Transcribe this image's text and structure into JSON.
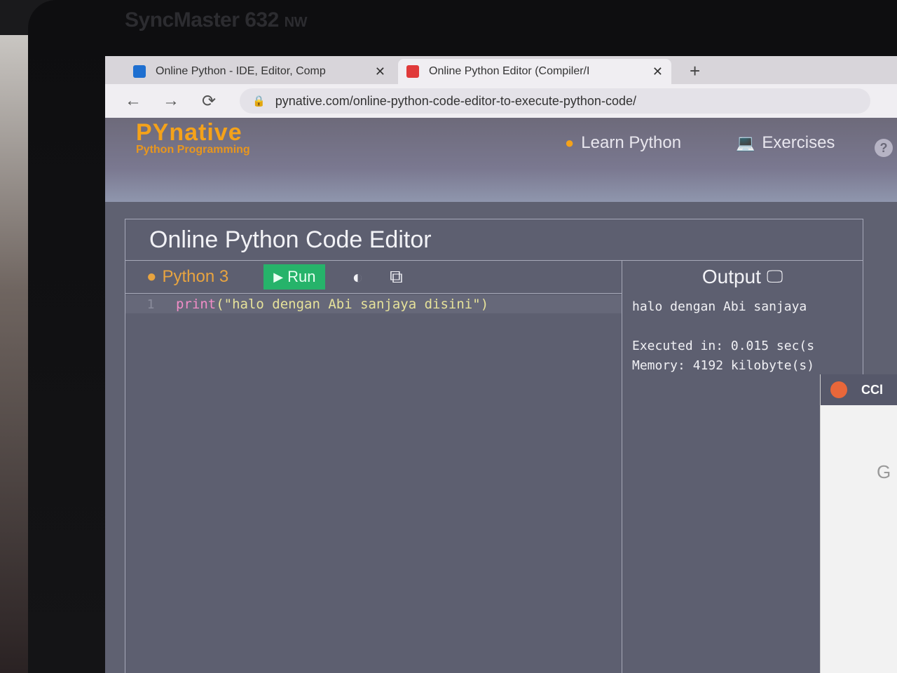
{
  "monitor": {
    "brand": "SyncMaster 632",
    "model_suffix": "NW"
  },
  "browser": {
    "tabs": [
      {
        "title": "Online Python - IDE, Editor, Comp",
        "close": "✕",
        "favicon_color": "#1e6fd0",
        "active": false
      },
      {
        "title": "Online Python Editor (Compiler/I",
        "close": "✕",
        "favicon_color": "#e03a3a",
        "active": true
      }
    ],
    "new_tab": "+",
    "nav": {
      "back": "←",
      "forward": "→",
      "reload": "⟳"
    },
    "url": "pynative.com/online-python-code-editor-to-execute-python-code/"
  },
  "site": {
    "logo_title": "PYnative",
    "logo_subtitle": "Python Programming",
    "nav": [
      {
        "label": "Learn Python",
        "icon": "python-logo-icon"
      },
      {
        "label": "Exercises",
        "icon": "laptop-icon"
      }
    ],
    "help": "?"
  },
  "editor": {
    "title": "Online Python Code Editor",
    "language": "Python 3",
    "run_label": "Run",
    "line_number": "1",
    "code_fn": "print",
    "code_args": "(\"halo dengan Abi sanjaya disini\")",
    "output_label": "Output",
    "output_text": "halo dengan Abi sanjaya\n\nExecuted in: 0.015 sec(s\nMemory: 4192 kilobyte(s)"
  },
  "popup": {
    "title": "CCl",
    "body": "G"
  },
  "colors": {
    "accent": "#f4a21a",
    "run": "#26b36a",
    "panel": "#5d5f70"
  }
}
